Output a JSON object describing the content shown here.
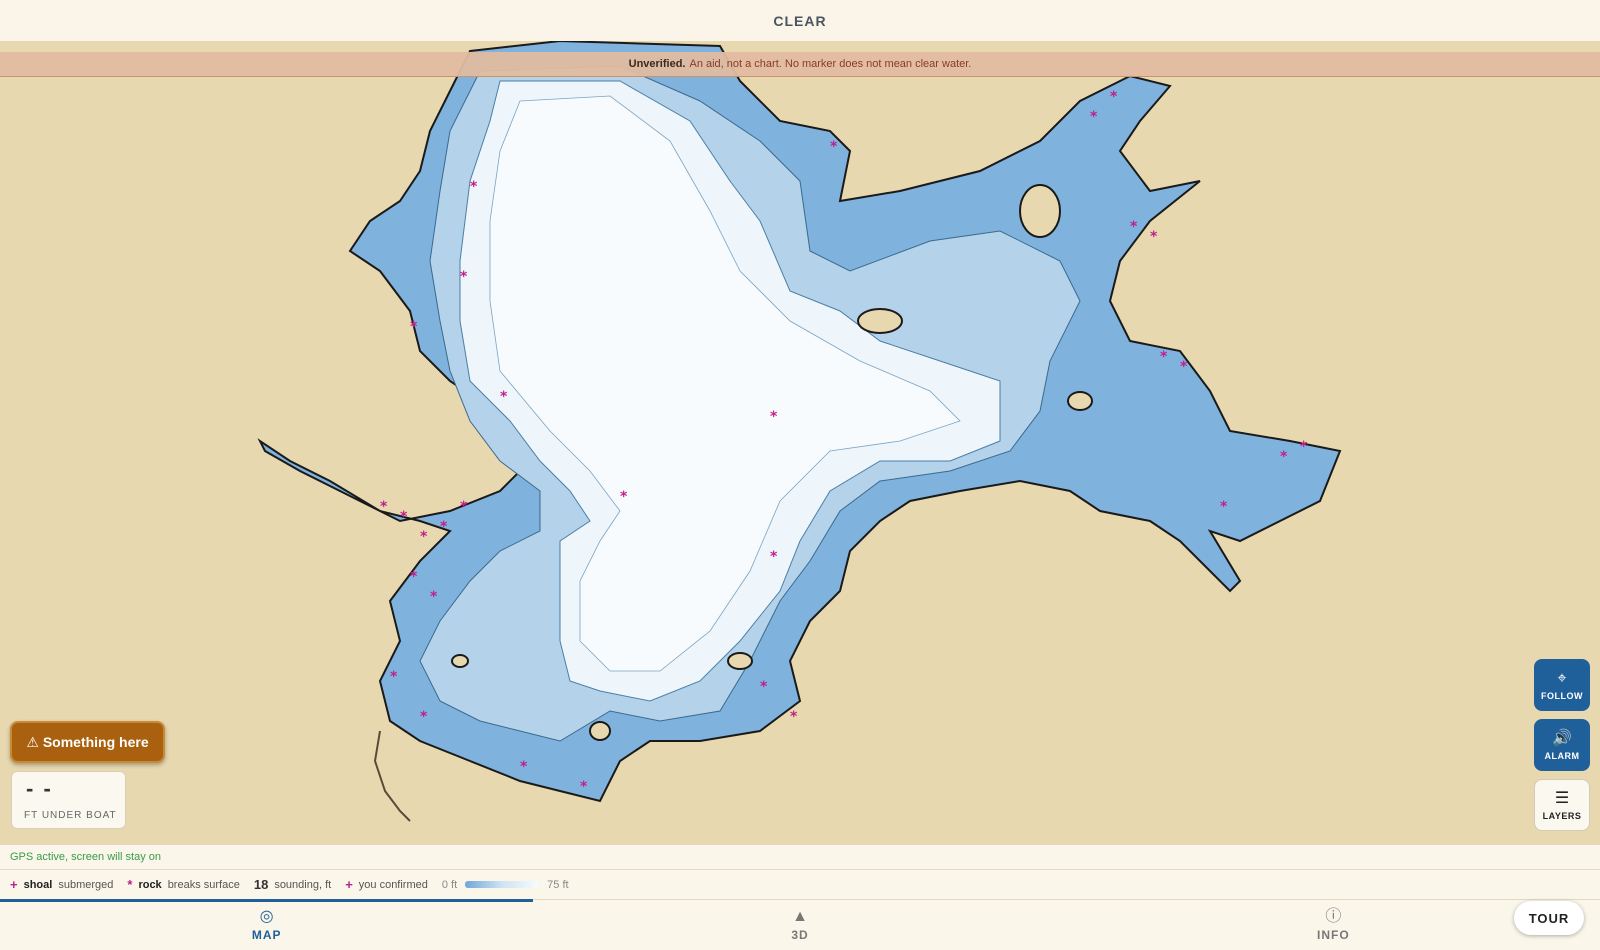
{
  "header": {
    "title": "CLEAR"
  },
  "warning": {
    "bold": "Unverified.",
    "text": "An aid, not a chart. No marker does not mean clear water."
  },
  "alert_button": {
    "label": "⚠ Something here"
  },
  "depth": {
    "value": "- -",
    "unit_label": "FT UNDER BOAT"
  },
  "side_buttons": [
    {
      "icon": "⌖",
      "label": "FOLLOW"
    },
    {
      "icon": "🔊",
      "label": "ALARM"
    },
    {
      "icon": "☰",
      "label": "LAYERS"
    }
  ],
  "status": {
    "text": "GPS active, screen will stay on"
  },
  "legend": {
    "shoal_symbol": "+",
    "shoal_label": "shoal",
    "shoal_desc": "submerged",
    "rock_symbol": "*",
    "rock_label": "rock",
    "rock_desc": "breaks surface",
    "sounding_value": "18",
    "sounding_desc": "sounding, ft",
    "confirmed_symbol": "+",
    "confirmed_desc": "you confirmed",
    "scale_min": "0 ft",
    "scale_max": "75 ft"
  },
  "tabs": [
    {
      "icon": "◎",
      "label": "MAP"
    },
    {
      "icon": "▲",
      "label": "3D"
    },
    {
      "icon": "ⓘ",
      "label": "INFO"
    }
  ],
  "tour_button": {
    "label": "TOUR"
  },
  "colors": {
    "land": "#e8d8b0",
    "shallow": "#7fb2dc",
    "deep": "#f5f9fd",
    "hazard": "#c0208a",
    "accent": "#1f5f9a"
  }
}
